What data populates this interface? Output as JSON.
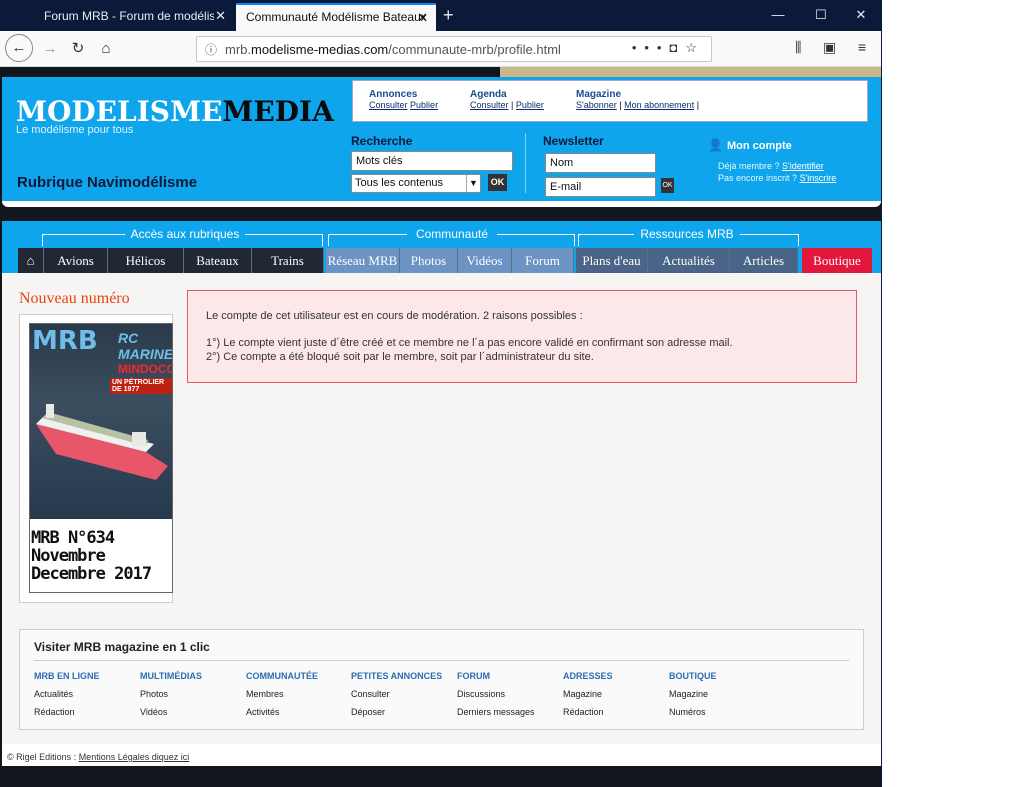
{
  "browser": {
    "tabs": [
      {
        "title": "Forum MRB - Forum de modélisme"
      },
      {
        "title": "Communauté Modélisme Bateaux"
      }
    ],
    "url_prefix": "mrb.",
    "url_host": "modelisme-medias.com",
    "url_path": "/communaute-mrb/profile.html"
  },
  "header": {
    "logo_part1": "MODELISME",
    "logo_part2": "MEDIA",
    "tagline": "Le modélisme pour tous",
    "rubrique": "Rubrique Navimodélisme",
    "topbox": {
      "annonces": {
        "title": "Annonces",
        "link1": "Consulter",
        "link2": "Publier"
      },
      "agenda": {
        "title": "Agenda",
        "link1": "Consulter",
        "sep": "|",
        "link2": "Publier"
      },
      "magazine": {
        "title": "Magazine",
        "link1": "S'abonner",
        "sep": "|",
        "link2": "Mon abonnement",
        "sep2": "|"
      }
    },
    "search": {
      "title": "Recherche",
      "keywords": "Mots clés",
      "scope": "Tous les contenus",
      "ok": "OK"
    },
    "newsletter": {
      "title": "Newsletter",
      "name": "Nom",
      "email": "E-mail",
      "ok": "OK"
    },
    "account": {
      "title": "Mon compte",
      "member_text": "Déjà membre ?",
      "member_link": "S'identifier",
      "join_text": "Pas encore inscrit ?",
      "join_link": "S'inscrire"
    }
  },
  "nav": {
    "groups": [
      "Accès aux rubriques",
      "Communauté",
      "Ressources MRB"
    ],
    "items": [
      "Avions",
      "Hélicos",
      "Bateaux",
      "Trains",
      "Réseau MRB",
      "Photos",
      "Vidéos",
      "Forum",
      "Plans d'eau",
      "Actualités",
      "Articles",
      "Boutique"
    ]
  },
  "sidebar": {
    "title": "Nouveau numéro",
    "cover": {
      "brand": "MRB",
      "brand2": "RC MARINE",
      "headline": "MINDOCO",
      "subline": "UN PÉTROLIER DE 1977",
      "caption_l1": "MRB N°634",
      "caption_l2": "Novembre",
      "caption_l3": "Decembre 2017"
    }
  },
  "alert": {
    "line1": "Le compte de cet utilisateur est en cours de modération. 2 raisons possibles :",
    "line2": "1°) Le compte vient juste d´être créé et ce membre ne l´a pas encore validé en confirmant son adresse mail.",
    "line3": "2°) Ce compte a été bloqué soit par le membre, soit par l´administrateur du site."
  },
  "footer": {
    "title": "Visiter MRB magazine en 1 clic",
    "columns": [
      {
        "head": "MRB EN LIGNE",
        "items": [
          "Actualités",
          "Rédaction"
        ]
      },
      {
        "head": "MULTIMÉDIAS",
        "items": [
          "Photos",
          "Vidéos"
        ]
      },
      {
        "head": "COMMUNAUTÉE",
        "items": [
          "Membres",
          "Activités"
        ]
      },
      {
        "head": "PETITES ANNONCES",
        "items": [
          "Consulter",
          "Déposer"
        ]
      },
      {
        "head": "FORUM",
        "items": [
          "Discussions",
          "Derniers messages"
        ]
      },
      {
        "head": "ADRESSES",
        "items": [
          "Magazine",
          "Rédaction"
        ]
      },
      {
        "head": "BOUTIQUE",
        "items": [
          "Magazine",
          "Numéros"
        ]
      }
    ],
    "copyright": "© Rigel Editions :",
    "legal_link": "Mentions Légales diquez ici"
  }
}
